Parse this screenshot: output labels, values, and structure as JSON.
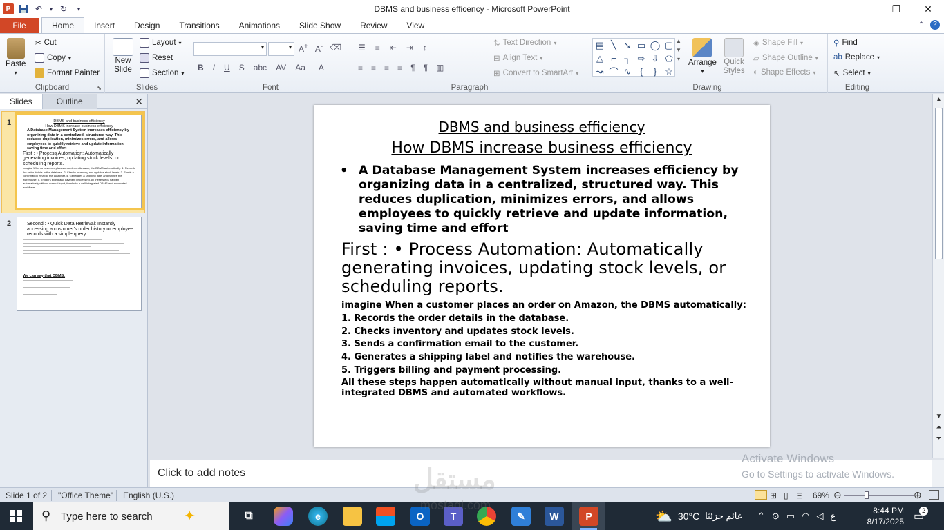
{
  "window": {
    "title": "DBMS and business efficency  -  Microsoft PowerPoint",
    "minimize": "—",
    "maximize": "❐",
    "close": "✕"
  },
  "tabs": [
    "File",
    "Home",
    "Insert",
    "Design",
    "Transitions",
    "Animations",
    "Slide Show",
    "Review",
    "View"
  ],
  "ribbon": {
    "clipboard": {
      "label": "Clipboard",
      "paste": "Paste",
      "cut": "Cut",
      "copy": "Copy",
      "format_painter": "Format Painter"
    },
    "slides": {
      "label": "Slides",
      "new_slide": "New Slide",
      "layout": "Layout",
      "reset": "Reset",
      "section": "Section"
    },
    "font": {
      "label": "Font"
    },
    "paragraph": {
      "label": "Paragraph",
      "text_direction": "Text Direction",
      "align_text": "Align Text",
      "convert_smartart": "Convert to SmartArt"
    },
    "drawing": {
      "label": "Drawing",
      "arrange": "Arrange",
      "quick_styles": "Quick Styles",
      "shape_fill": "Shape Fill",
      "shape_outline": "Shape Outline",
      "shape_effects": "Shape Effects"
    },
    "editing": {
      "label": "Editing",
      "find": "Find",
      "replace": "Replace",
      "select": "Select"
    }
  },
  "left_pane": {
    "tabs": [
      "Slides",
      "Outline"
    ],
    "thumbnails": [
      {
        "number": "1",
        "lines": [
          "DBMS and business efficiency",
          "How DBMS increase business efficiency",
          "A Database Management System increases efficiency by organizing data in a centralized, structured way. This reduces duplication, minimizes errors, and allows employees to quickly retrieve and update information, saving time and effort",
          "First : • Process Automation: Automatically generating invoices, updating stock levels, or scheduling reports.",
          "imagine When a customer places an order on Amazon, the DBMS automatically: 1. Records the order details in the database. 2. Checks inventory and updates stock levels. 3. Sends a confirmation email to the customer. 4. Generates a shipping label and notifies the warehouse. 5. Triggers billing and payment processing. All these steps happen automatically without manual input, thanks to a well-integrated DBMS and automated workflows."
        ]
      },
      {
        "number": "2",
        "lines": [
          "Second : • Quick Data Retrieval: Instantly accessing a customer's order history or employee records with a simple query.",
          "We can say that DBMS:"
        ]
      }
    ]
  },
  "slide": {
    "title1": "DBMS and business efficiency",
    "title2": "How DBMS increase business efficiency",
    "bullet": "A Database Management System increases efficiency by organizing data in  a centralized, structured way. This reduces duplication, minimizes errors, and allows employees to quickly retrieve and update information, saving time and effort",
    "first": "First :  • Process Automation: Automatically generating invoices, updating stock levels, or scheduling reports.",
    "imagine": " imagine When a customer places an order on Amazon, the DBMS automatically:",
    "steps": [
      "1. Records the order details in the database.",
      " 2. Checks inventory and updates stock levels.",
      " 3. Sends a confirmation email to the customer.",
      " 4. Generates a shipping label and notifies the warehouse.",
      " 5. Triggers billing and payment processing."
    ],
    "final": "All these steps happen automatically without manual input, thanks to a well-integrated DBMS and automated workflows."
  },
  "notes_placeholder": "Click to add notes",
  "activation": {
    "line1": "Activate Windows",
    "line2": "Go to Settings to activate Windows."
  },
  "status": {
    "slide": "Slide 1 of 2",
    "theme": "\"Office Theme\"",
    "language": "English (U.S.)",
    "zoom": "69%"
  },
  "taskbar": {
    "search_placeholder": "Type here to search",
    "weather": "30°C",
    "weather_desc": "غائم جزئيًا",
    "time": "8:44 PM",
    "date": "8/17/2025",
    "lang": "ع",
    "notifications": "2"
  },
  "watermark": {
    "ar": "مستقل",
    "en": "mostaql.com"
  },
  "colors": {
    "file_tab": "#d24726",
    "selection": "#f4c54d",
    "taskbar": "#1f2a36"
  }
}
